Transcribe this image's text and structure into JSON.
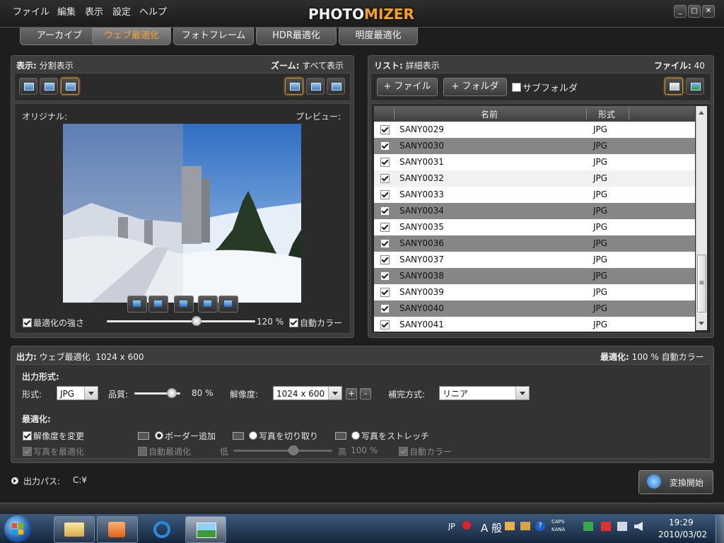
{
  "menu": [
    "ファイル",
    "編集",
    "表示",
    "設定",
    "ヘルプ"
  ],
  "logo": {
    "left": "PHOTO",
    "right": "MIZER"
  },
  "window_controls": [
    "_",
    "□",
    "✕"
  ],
  "tabs": [
    {
      "label": "アーカイブ",
      "active": false
    },
    {
      "label": "ウェブ最適化",
      "active": true
    },
    {
      "label": "フォトフレーム",
      "active": false
    },
    {
      "label": "HDR最適化",
      "active": false
    },
    {
      "label": "明度最適化",
      "active": false
    }
  ],
  "left_panel": {
    "display_label": "表示:",
    "display_value": "分割表示",
    "zoom_label": "ズーム:",
    "zoom_value": "すべて表示",
    "original_label": "オリジナル:",
    "preview_label": "プレビュー:",
    "strength_label": "最適化の強さ",
    "strength_value": "120 %",
    "strength_fraction": 0.6,
    "auto_color_label": "自動カラー"
  },
  "right_panel": {
    "list_label": "リスト:",
    "list_value": "詳細表示",
    "files_label": "ファイル:",
    "files_value": "40",
    "add_file_label": "+ ファイル",
    "add_folder_label": "+ フォルダ",
    "subfolder_label": "サブフォルダ",
    "col_name": "名前",
    "col_format": "形式",
    "files": [
      {
        "name": "SANY0029",
        "format": "JPG"
      },
      {
        "name": "SANY0030",
        "format": "JPG"
      },
      {
        "name": "SANY0031",
        "format": "JPG"
      },
      {
        "name": "SANY0032",
        "format": "JPG"
      },
      {
        "name": "SANY0033",
        "format": "JPG"
      },
      {
        "name": "SANY0034",
        "format": "JPG"
      },
      {
        "name": "SANY0035",
        "format": "JPG"
      },
      {
        "name": "SANY0036",
        "format": "JPG"
      },
      {
        "name": "SANY0037",
        "format": "JPG"
      },
      {
        "name": "SANY0038",
        "format": "JPG"
      },
      {
        "name": "SANY0039",
        "format": "JPG"
      },
      {
        "name": "SANY0040",
        "format": "JPG"
      },
      {
        "name": "SANY0041",
        "format": "JPG"
      }
    ],
    "scroll_grip": "≡"
  },
  "output": {
    "header_label": "出力:",
    "header_value": "ウェブ最適化",
    "header_size": "1024 x 600",
    "optimize_label": "最適化:",
    "optimize_value": "100 %",
    "optimize_auto": "自動カラー",
    "format_section": "出力形式:",
    "format_label": "形式:",
    "format_value": "JPG",
    "quality_label": "品質:",
    "quality_value": "80 %",
    "quality_fraction": 0.8,
    "resolution_label": "解像度:",
    "resolution_value": "1024 x 600",
    "plus": "+",
    "minus": "-",
    "interp_label": "補完方式:",
    "interp_value": "リニア",
    "optim_section": "最適化:",
    "change_res_label": "解像度を変更",
    "border_label": "ボーダー追加",
    "crop_label": "写真を切り取り",
    "stretch_label": "写真をストレッチ",
    "optimize_photo_label": "写真を最適化",
    "auto_opt_label": "自動最適化",
    "low_label": "低",
    "high_label": "高",
    "high_value": "100 %",
    "high_fraction": 0.6,
    "auto_color_label": "自動カラー",
    "path_label": "出力パス:",
    "path_value": "C:¥",
    "start_label": "変換開始"
  },
  "taskbar": {
    "lang": "JP",
    "ime": "A 般",
    "caps": "CAPS",
    "kana": "KANA",
    "time": "19:29",
    "date": "2010/03/02"
  },
  "colors": {
    "accent": "#f2a43a",
    "background": "#1e1e1e",
    "panel": "#3d3d3d"
  }
}
